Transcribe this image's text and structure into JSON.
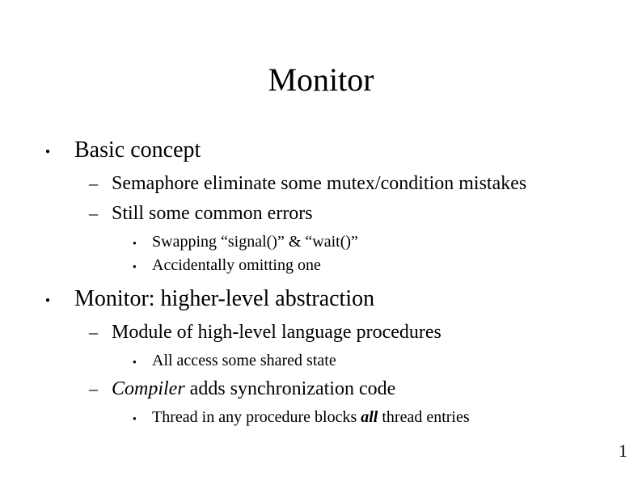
{
  "title": "Monitor",
  "bullets": {
    "b1": {
      "text": "Basic concept",
      "sub": {
        "s1": "Semaphore eliminate some mutex/condition mistakes",
        "s2": {
          "text": "Still some common errors",
          "sub": {
            "t1": "Swapping “signal()” & “wait()”",
            "t2": "Accidentally omitting one"
          }
        }
      }
    },
    "b2": {
      "text": "Monitor: higher-level abstraction",
      "sub": {
        "s1": {
          "text": "Module of high-level language procedures",
          "sub": {
            "t1": "All access some shared state"
          }
        },
        "s2": {
          "prefix_italic": "Compiler",
          "rest": " adds synchronization code",
          "sub": {
            "t1_pre": "Thread in any procedure blocks ",
            "t1_emph": "all",
            "t1_post": " thread entries"
          }
        }
      }
    }
  },
  "page_number": "1"
}
